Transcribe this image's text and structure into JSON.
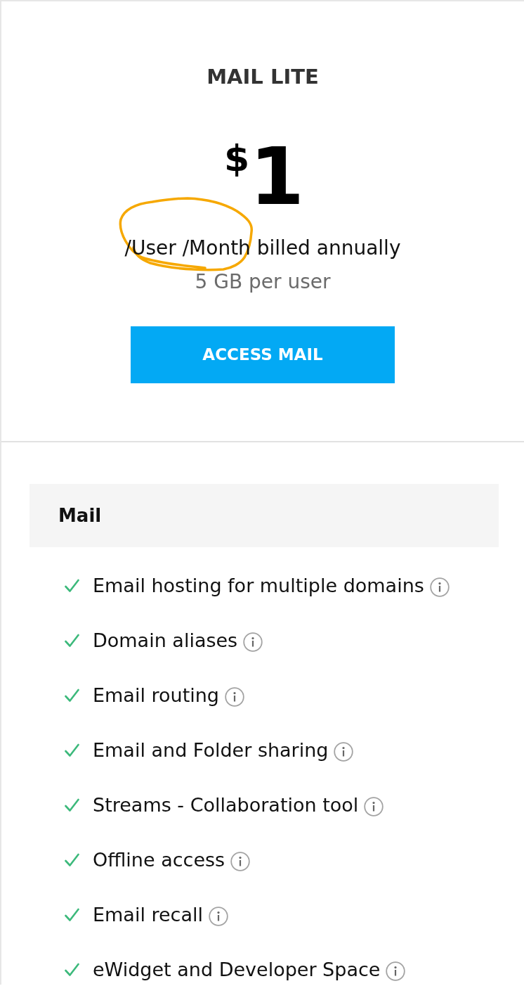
{
  "plan": {
    "name": "MAIL LITE",
    "currency": "$",
    "amount": "1",
    "billing": "/User /Month billed annually",
    "storage": "5 GB per user",
    "button": "ACCESS MAIL"
  },
  "annotation": {
    "kind": "circle"
  },
  "section": {
    "title": "Mail",
    "features": [
      {
        "label": "Email hosting for multiple domains",
        "included": true
      },
      {
        "label": "Domain aliases",
        "included": true
      },
      {
        "label": "Email routing",
        "included": true
      },
      {
        "label": "Email and Folder sharing",
        "included": true
      },
      {
        "label": "Streams - Collaboration tool",
        "included": true
      },
      {
        "label": "Offline access",
        "included": true
      },
      {
        "label": "Email recall",
        "included": true
      },
      {
        "label": "eWidget and Developer Space",
        "included": true
      }
    ]
  }
}
